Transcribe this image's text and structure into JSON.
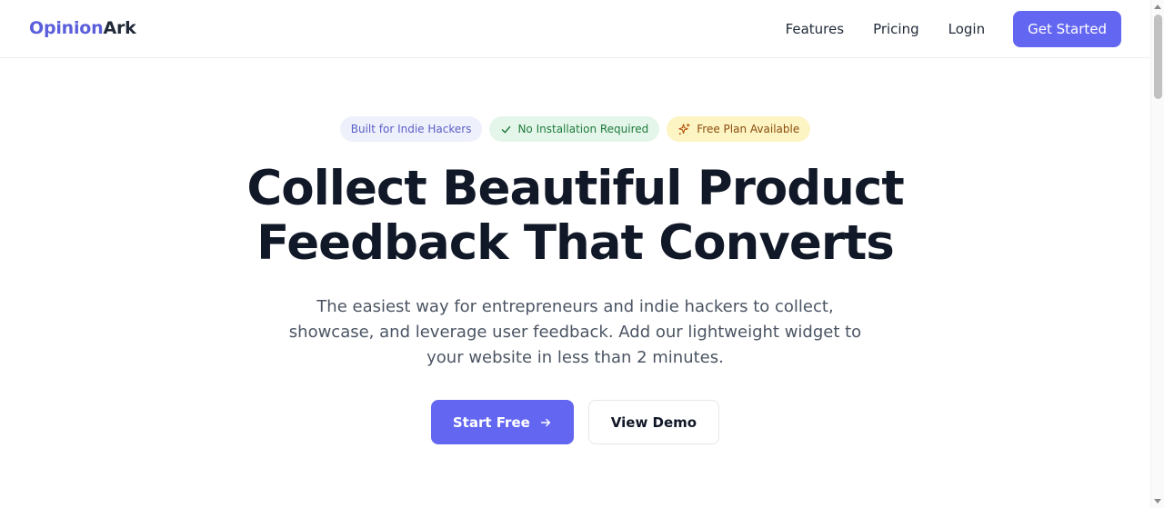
{
  "brand": {
    "name_part1": "Opinion",
    "name_part2": "Ark",
    "accent_color": "#6366f1"
  },
  "nav": {
    "items": [
      {
        "label": "Features"
      },
      {
        "label": "Pricing"
      },
      {
        "label": "Login"
      }
    ],
    "cta_label": "Get Started"
  },
  "hero": {
    "badges": [
      {
        "label": "Built for Indie Hackers",
        "icon": ""
      },
      {
        "label": "No Installation Required",
        "icon": "check-icon"
      },
      {
        "label": "Free Plan Available",
        "icon": "sparkles-icon"
      }
    ],
    "title_line1": "Collect Beautiful Product",
    "title_line2": "Feedback That Converts",
    "subtitle": "The easiest way for entrepreneurs and indie hackers to collect, showcase, and leverage user feedback. Add our lightweight widget to your website in less than 2 minutes.",
    "primary_cta": "Start Free",
    "secondary_cta": "View Demo"
  }
}
